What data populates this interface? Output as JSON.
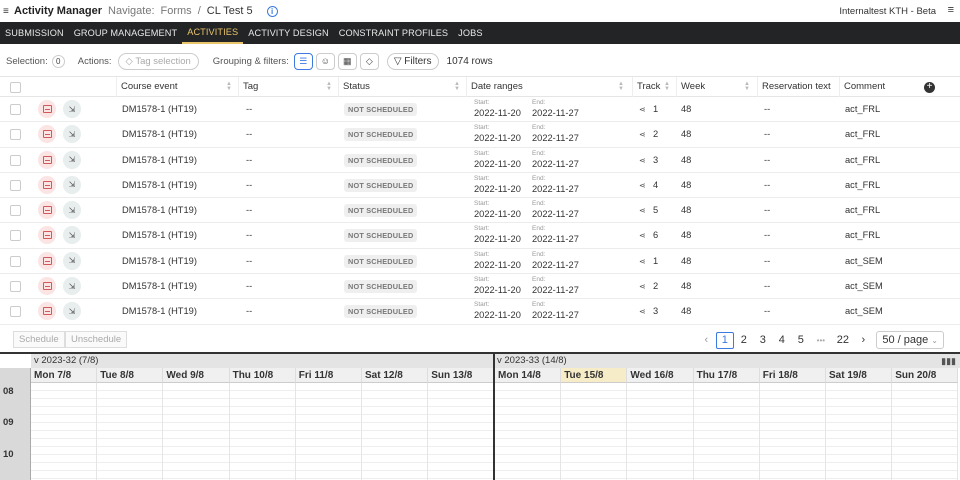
{
  "header": {
    "app_title": "Activity Manager",
    "navigate_label": "Navigate:",
    "crumb_forms": "Forms",
    "crumb_separator": "/",
    "crumb_current": "CL Test 5",
    "environment": "Internaltest KTH - Beta"
  },
  "tabs": [
    "SUBMISSION",
    "GROUP MANAGEMENT",
    "ACTIVITIES",
    "ACTIVITY DESIGN",
    "CONSTRAINT PROFILES",
    "JOBS"
  ],
  "active_tab": "ACTIVITIES",
  "toolbar": {
    "selection_label": "Selection:",
    "selection_count": "0",
    "actions_label": "Actions:",
    "tag_selection": "Tag selection",
    "grouping_label": "Grouping & filters:",
    "filters_label": "Filters",
    "row_count": "1074 rows"
  },
  "columns": {
    "course_event": "Course event",
    "tag": "Tag",
    "status": "Status",
    "date_ranges": "Date ranges",
    "track": "Track",
    "week": "Week",
    "reservation_text": "Reservation text",
    "comment": "Comment"
  },
  "date_labels": {
    "start": "Start:",
    "end": "End:"
  },
  "rows": [
    {
      "course_event": "DM1578-1 (HT19)",
      "tag": "--",
      "status": "NOT SCHEDULED",
      "start": "2022-11-20",
      "end": "2022-11-27",
      "track": "1",
      "week": "48",
      "reservation_text": "--",
      "comment": "act_FRL"
    },
    {
      "course_event": "DM1578-1 (HT19)",
      "tag": "--",
      "status": "NOT SCHEDULED",
      "start": "2022-11-20",
      "end": "2022-11-27",
      "track": "2",
      "week": "48",
      "reservation_text": "--",
      "comment": "act_FRL"
    },
    {
      "course_event": "DM1578-1 (HT19)",
      "tag": "--",
      "status": "NOT SCHEDULED",
      "start": "2022-11-20",
      "end": "2022-11-27",
      "track": "3",
      "week": "48",
      "reservation_text": "--",
      "comment": "act_FRL"
    },
    {
      "course_event": "DM1578-1 (HT19)",
      "tag": "--",
      "status": "NOT SCHEDULED",
      "start": "2022-11-20",
      "end": "2022-11-27",
      "track": "4",
      "week": "48",
      "reservation_text": "--",
      "comment": "act_FRL"
    },
    {
      "course_event": "DM1578-1 (HT19)",
      "tag": "--",
      "status": "NOT SCHEDULED",
      "start": "2022-11-20",
      "end": "2022-11-27",
      "track": "5",
      "week": "48",
      "reservation_text": "--",
      "comment": "act_FRL"
    },
    {
      "course_event": "DM1578-1 (HT19)",
      "tag": "--",
      "status": "NOT SCHEDULED",
      "start": "2022-11-20",
      "end": "2022-11-27",
      "track": "6",
      "week": "48",
      "reservation_text": "--",
      "comment": "act_FRL"
    },
    {
      "course_event": "DM1578-1 (HT19)",
      "tag": "--",
      "status": "NOT SCHEDULED",
      "start": "2022-11-20",
      "end": "2022-11-27",
      "track": "1",
      "week": "48",
      "reservation_text": "--",
      "comment": "act_SEM"
    },
    {
      "course_event": "DM1578-1 (HT19)",
      "tag": "--",
      "status": "NOT SCHEDULED",
      "start": "2022-11-20",
      "end": "2022-11-27",
      "track": "2",
      "week": "48",
      "reservation_text": "--",
      "comment": "act_SEM"
    },
    {
      "course_event": "DM1578-1 (HT19)",
      "tag": "--",
      "status": "NOT SCHEDULED",
      "start": "2022-11-20",
      "end": "2022-11-27",
      "track": "3",
      "week": "48",
      "reservation_text": "--",
      "comment": "act_SEM"
    }
  ],
  "bottom": {
    "schedule": "Schedule",
    "unschedule": "Unschedule",
    "pages": [
      "1",
      "2",
      "3",
      "4",
      "5"
    ],
    "ellipsis": "•••",
    "last_page": "22",
    "current_page": "1",
    "page_size": "50 / page"
  },
  "calendar": {
    "weeks": [
      "v 2023-32 (7/8)",
      "v 2023-33 (14/8)"
    ],
    "days": [
      "Mon 7/8",
      "Tue 8/8",
      "Wed 9/8",
      "Thu 10/8",
      "Fri 11/8",
      "Sat 12/8",
      "Sun 13/8",
      "Mon 14/8",
      "Tue 15/8",
      "Wed 16/8",
      "Thu 17/8",
      "Fri 18/8",
      "Sat 19/8",
      "Sun 20/8"
    ],
    "highlighted_day": "Tue 15/8",
    "hours": [
      "08",
      "09",
      "10"
    ]
  },
  "colors": {
    "tabbar_bg": "#222426",
    "active_tab": "#e9c46a",
    "accent": "#3b7be0",
    "highlight_day": "#f6ecc7"
  }
}
